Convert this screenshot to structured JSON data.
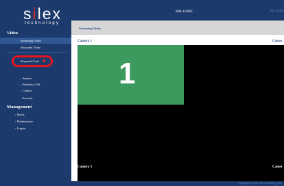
{
  "brand": {
    "logo_prefix": "s",
    "logo_dot": "i",
    "logo_suffix": "lex",
    "tagline": "technology"
  },
  "header": {
    "model": "RM-100RC",
    "version": "Ver.1.0.0a"
  },
  "sidebar": {
    "video_heading": "Video",
    "video_items": [
      {
        "label": "Streaming Video",
        "active": true
      },
      {
        "label": "Recorded Video",
        "active": false
      }
    ],
    "required_conf": "Required Conf.",
    "settings_items": [
      {
        "label": "System"
      },
      {
        "label": "Wireless LAN"
      },
      {
        "label": "Camera"
      },
      {
        "label": "Security"
      }
    ],
    "management_heading": "Management",
    "management_items": [
      {
        "label": "Status"
      },
      {
        "label": "Maintenance"
      },
      {
        "label": "Logout"
      }
    ]
  },
  "main": {
    "page_title": "Streaming Video",
    "camera_labels": {
      "cam1": "Camera 1",
      "cam2": "Camer",
      "cam3": "Camera 3",
      "cam4": "Camer"
    },
    "tile_number": "1"
  },
  "footer": {
    "copyright": "Copyright (C) 2021 silex technology, Inc."
  },
  "colors": {
    "navy": "#1c3a6b",
    "active": "#2f5894",
    "highlight_ring": "#e8141e",
    "tile_green": "#3c9a5f"
  }
}
